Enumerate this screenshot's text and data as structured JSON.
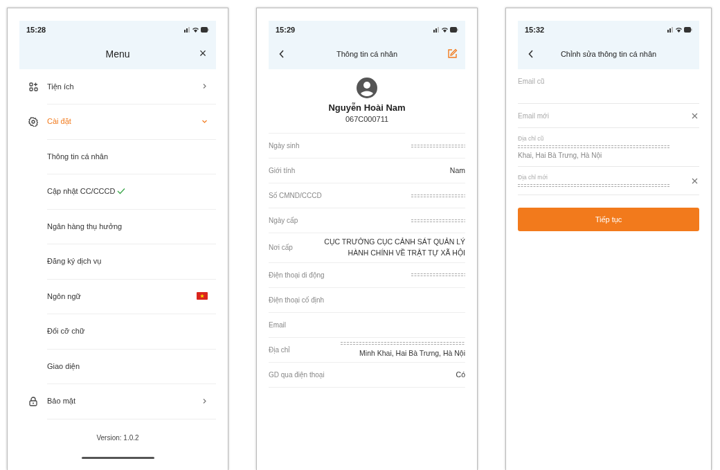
{
  "menu_screen": {
    "status_bar": {
      "time": "15:28"
    },
    "title": "Menu",
    "close": "×",
    "items": [
      {
        "kind": "section",
        "label": "Tiện ích",
        "expanded": false
      },
      {
        "kind": "section",
        "label": "Cài đặt",
        "expanded": true
      },
      {
        "kind": "sub",
        "label": "Thông tin cá nhân",
        "verified": false
      },
      {
        "kind": "sub",
        "label": "Cập nhật CC/CCCD",
        "verified": true
      },
      {
        "kind": "sub",
        "label": "Ngân hàng thụ hưởng",
        "verified": false
      },
      {
        "kind": "sub",
        "label": "Đăng ký dịch vụ",
        "verified": false
      },
      {
        "kind": "language",
        "label": "Ngôn ngữ"
      },
      {
        "kind": "sub",
        "label": "Đổi cỡ chữ",
        "verified": false
      },
      {
        "kind": "sub",
        "label": "Giao diện",
        "verified": false
      },
      {
        "kind": "section",
        "label": "Bảo mật",
        "expanded": false
      }
    ],
    "version": "Version: 1.0.2"
  },
  "profile_screen": {
    "status_bar": {
      "time": "15:29"
    },
    "title": "Thông tin cá nhân",
    "name": "Nguyễn Hoài Nam",
    "code": "067C000711",
    "rows": [
      {
        "label": "Ngày sinh",
        "redacted": true
      },
      {
        "label": "Giới tính",
        "value": "Nam",
        "redacted": false
      },
      {
        "label": "Số CMND/CCCD",
        "redacted": true
      },
      {
        "label": "Ngày cấp",
        "redacted": true
      },
      {
        "label": "Nơi cấp",
        "value": "CỤC TRƯỞNG CỤC CẢNH SÁT QUẢN LÝ HÀNH CHÍNH VỀ TRẬT TỰ XÃ HỘI",
        "redacted": false
      },
      {
        "label": "Điện thoại di động",
        "redacted": true
      },
      {
        "label": "Điện thoại cố định",
        "redacted": false
      },
      {
        "label": "Email",
        "redacted": false
      },
      {
        "label": "Địa chỉ",
        "value": "Minh Khai, Hai Bà Trưng, Hà Nội",
        "redacted": true
      },
      {
        "label": "GD qua điện thoại",
        "value": "Có",
        "redacted": false
      }
    ]
  },
  "edit_screen": {
    "status_bar": {
      "time": "15:32"
    },
    "title": "Chỉnh sửa thông tin cá nhân",
    "fields": [
      {
        "kind": "placeholder",
        "placeholder": "Email cũ",
        "clearable": false
      },
      {
        "kind": "placeholder",
        "placeholder": "Email mới",
        "clearable": true
      },
      {
        "kind": "floating",
        "label": "Địa chỉ cũ",
        "value": "Khai, Hai Bà Trưng, Hà Nội",
        "clearable": false,
        "redacted": true
      },
      {
        "kind": "floating",
        "label": "Địa chỉ mới",
        "clearable": true,
        "redacted": true
      }
    ],
    "button": "Tiếp tục"
  }
}
